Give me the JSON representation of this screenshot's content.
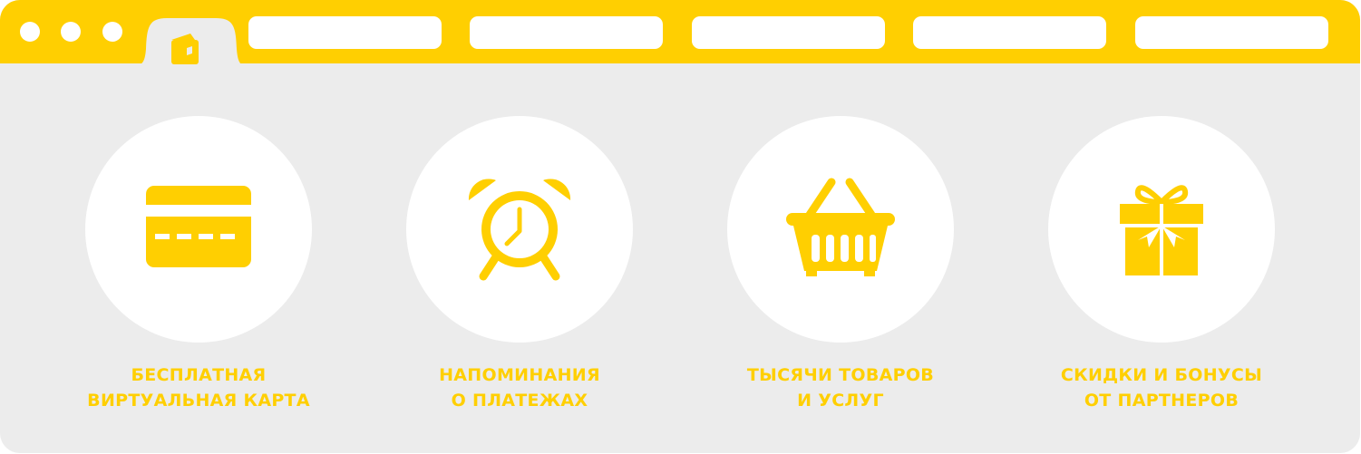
{
  "colors": {
    "accent": "#ffcf01",
    "content_bg": "#ececec",
    "surface": "#ffffff"
  },
  "browser": {
    "window_controls": [
      "dot-icon",
      "dot-icon",
      "dot-icon"
    ],
    "active_tab_icon": "wallet-icon",
    "tab_count": 5
  },
  "features": [
    {
      "icon": "credit-card-icon",
      "lines": [
        "БЕСПЛАТНАЯ",
        "ВИРТУАЛЬНАЯ КАРТА"
      ]
    },
    {
      "icon": "alarm-clock-icon",
      "lines": [
        "НАПОМИНАНИЯ",
        "О ПЛАТЕЖАХ"
      ]
    },
    {
      "icon": "shopping-basket-icon",
      "lines": [
        "ТЫСЯЧИ ТОВАРОВ",
        "И УСЛУГ"
      ]
    },
    {
      "icon": "gift-icon",
      "lines": [
        "СКИДКИ И БОНУСЫ",
        "ОТ ПАРТНЕРОВ"
      ]
    }
  ]
}
